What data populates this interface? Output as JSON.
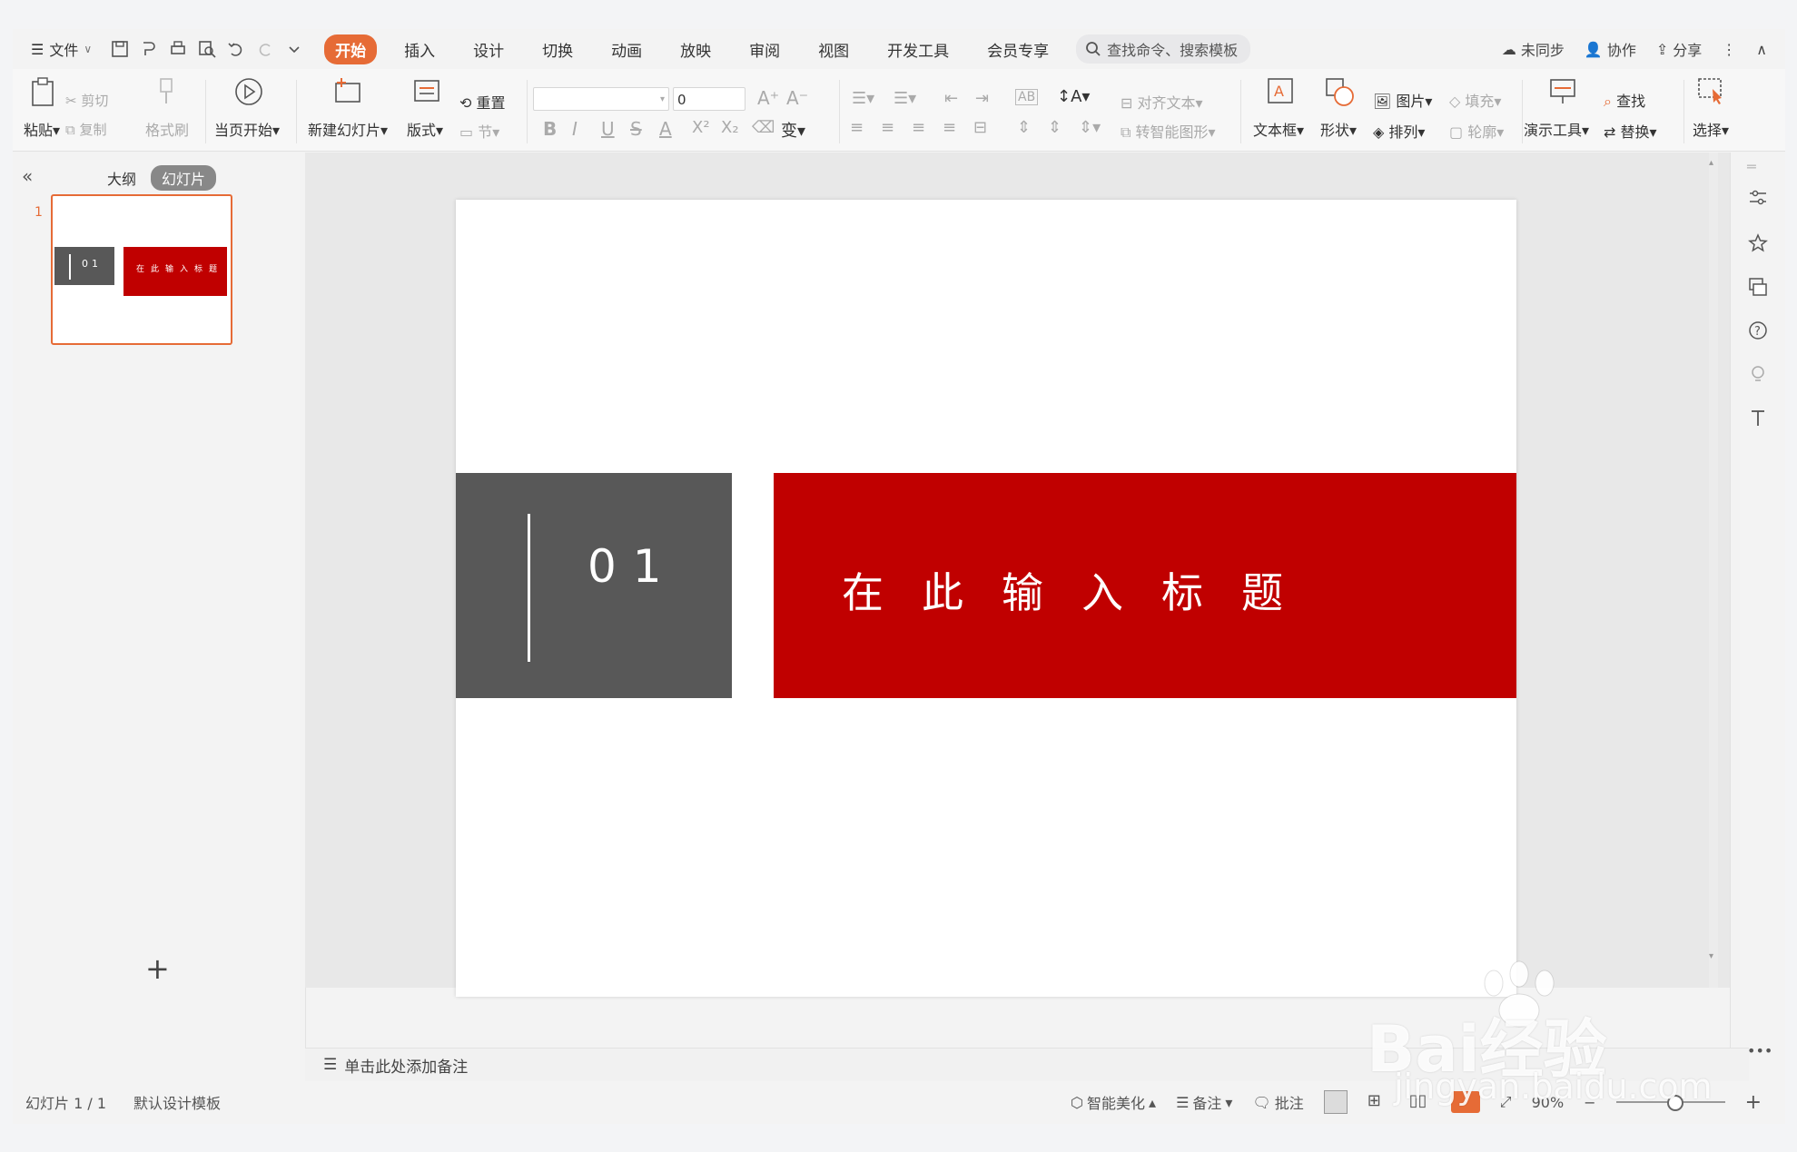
{
  "menubar": {
    "file_label": "文件",
    "tabs": [
      "开始",
      "插入",
      "设计",
      "切换",
      "动画",
      "放映",
      "审阅",
      "视图",
      "开发工具",
      "会员专享"
    ],
    "search_placeholder": "查找命令、搜索模板",
    "unsync": "未同步",
    "collab": "协作",
    "share": "分享"
  },
  "ribbon": {
    "paste": "粘贴",
    "cut": "剪切",
    "copy": "复制",
    "format_painter": "格式刷",
    "play_current": "当页开始",
    "new_slide": "新建幻灯片",
    "layout": "版式",
    "reset": "重置",
    "section": "节",
    "font_size": "0",
    "align_text": "对齐文本",
    "smart_art": "转智能图形",
    "textbox": "文本框",
    "shape": "形状",
    "picture": "图片",
    "fill": "填充",
    "arrange": "排列",
    "outline": "轮廓",
    "present_tools": "演示工具",
    "find": "查找",
    "replace": "替换",
    "select": "选择"
  },
  "leftpane": {
    "outline_tab": "大纲",
    "slides_tab": "幻灯片",
    "slide_number": "1"
  },
  "slide": {
    "number_text": "01",
    "title_text": "在此输入标题",
    "gray_color": "#585858",
    "red_color": "#c00000"
  },
  "notes": {
    "placeholder": "单击此处添加备注"
  },
  "statusbar": {
    "slide_count": "幻灯片 1 / 1",
    "template": "默认设计模板",
    "beautify": "智能美化",
    "notes": "备注",
    "comments": "批注",
    "zoom": "90%"
  },
  "watermark": {
    "brand": "Bai经验",
    "url": "jingyan.baidu.com"
  }
}
